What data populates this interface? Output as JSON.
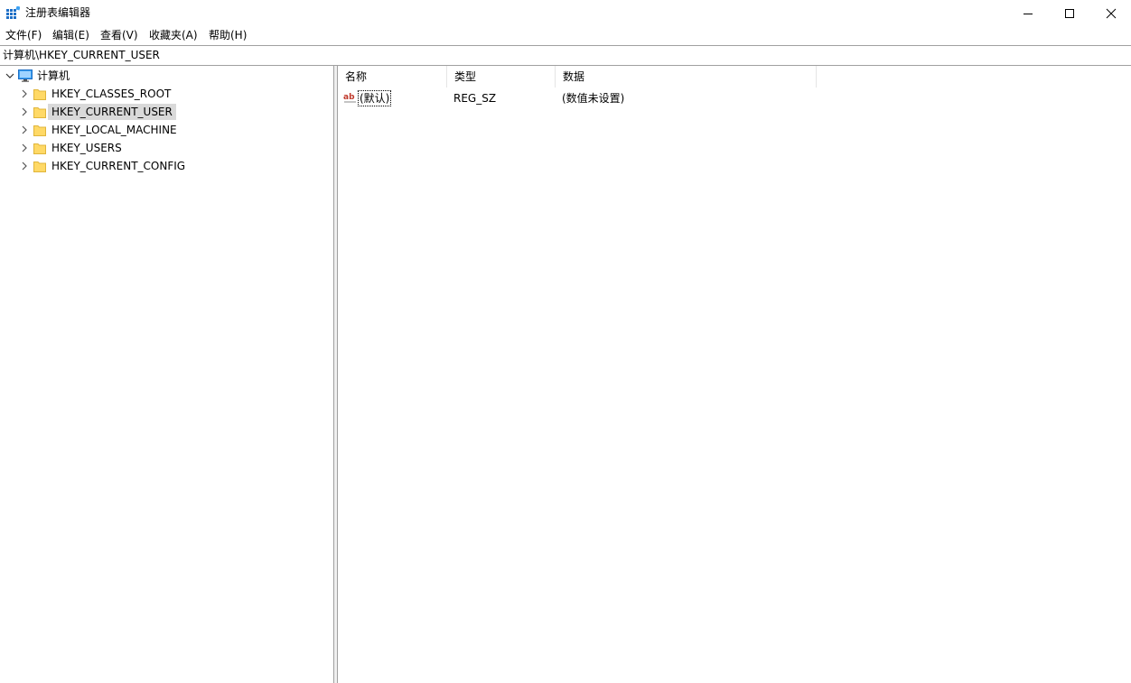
{
  "window": {
    "title": "注册表编辑器",
    "controls": {
      "minimize": "minimize",
      "maximize": "maximize",
      "close": "close"
    }
  },
  "menu": {
    "items": [
      {
        "label": "文件(F)"
      },
      {
        "label": "编辑(E)"
      },
      {
        "label": "查看(V)"
      },
      {
        "label": "收藏夹(A)"
      },
      {
        "label": "帮助(H)"
      }
    ]
  },
  "address": {
    "path": "计算机\\HKEY_CURRENT_USER"
  },
  "tree": {
    "root": {
      "label": "计算机",
      "expanded": true,
      "icon": "computer-icon"
    },
    "items": [
      {
        "label": "HKEY_CLASSES_ROOT",
        "selected": false
      },
      {
        "label": "HKEY_CURRENT_USER",
        "selected": true
      },
      {
        "label": "HKEY_LOCAL_MACHINE",
        "selected": false
      },
      {
        "label": "HKEY_USERS",
        "selected": false
      },
      {
        "label": "HKEY_CURRENT_CONFIG",
        "selected": false
      }
    ]
  },
  "list": {
    "columns": [
      {
        "label": "名称"
      },
      {
        "label": "类型"
      },
      {
        "label": "数据"
      }
    ],
    "rows": [
      {
        "name": "(默认)",
        "type": "REG_SZ",
        "data": "(数值未设置)",
        "icon": "string-value-icon"
      }
    ]
  },
  "colors": {
    "selection": "#d9d9d9",
    "folder": "#ffd966",
    "accent": "#0078d7",
    "string_icon": "#c0392b"
  }
}
